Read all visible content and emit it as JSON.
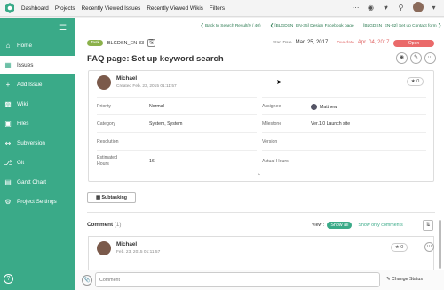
{
  "topnav": {
    "items": [
      "Dashboard",
      "Projects",
      "Recently Viewed Issues",
      "Recently Viewed Wikis",
      "Filters"
    ]
  },
  "sidebar": {
    "items": [
      {
        "label": "Home",
        "icon": "home-icon"
      },
      {
        "label": "Issues",
        "icon": "issues-icon"
      },
      {
        "label": "Add Issue",
        "icon": "plus-icon"
      },
      {
        "label": "Wiki",
        "icon": "wiki-icon"
      },
      {
        "label": "Files",
        "icon": "folder-icon"
      },
      {
        "label": "Subversion",
        "icon": "svn-icon"
      },
      {
        "label": "Git",
        "icon": "git-icon"
      },
      {
        "label": "Gantt Chart",
        "icon": "gantt-icon"
      },
      {
        "label": "Project Settings",
        "icon": "gear-icon"
      }
    ],
    "active_index": 1
  },
  "crumbs": {
    "back": "Back to Search Result(9 / 40)",
    "prev": "[BLGDSN_EN-35] Design Facebook page",
    "next": "[BLGDSN_EN-32] Set up Contact form"
  },
  "issue": {
    "tag": "Task",
    "key": "BLGDSN_EN-33",
    "start_label": "Start Date",
    "start_date": "Mar. 25, 2017",
    "due_label": "Due date",
    "due_date": "Apr. 04, 2017",
    "status": "Open",
    "title": "FAQ page: Set up keyword search",
    "author": "Michael",
    "created": "Created  Feb. 23, 2015 01:11:57",
    "stars": "0"
  },
  "fields": {
    "left": [
      {
        "label": "Priority",
        "value": "Normal"
      },
      {
        "label": "Category",
        "value": "System, System"
      },
      {
        "label": "Resolution",
        "value": ""
      },
      {
        "label": "Estimated Hours",
        "value": "16"
      }
    ],
    "right": [
      {
        "label": "Assignee",
        "value": "Matthew"
      },
      {
        "label": "Milestone",
        "value": "Ver.1.0 Launch site"
      },
      {
        "label": "Version",
        "value": ""
      },
      {
        "label": "Actual Hours",
        "value": ""
      }
    ]
  },
  "subtasking_label": "Subtasking",
  "comments": {
    "heading": "Comment",
    "count": "(1)",
    "view_label": "View :",
    "show_all": "Show all",
    "show_only": "Show only comments",
    "first": {
      "author": "Michael",
      "date": "Feb. 23, 2015 01:11:57",
      "stars": "0"
    }
  },
  "bottom": {
    "comment_placeholder": "Comment",
    "change_status": "Change Status"
  },
  "colors": {
    "sidebar": "#3aaa88",
    "status_open": "#ea6a6a",
    "task_tag": "#8bb14b"
  }
}
